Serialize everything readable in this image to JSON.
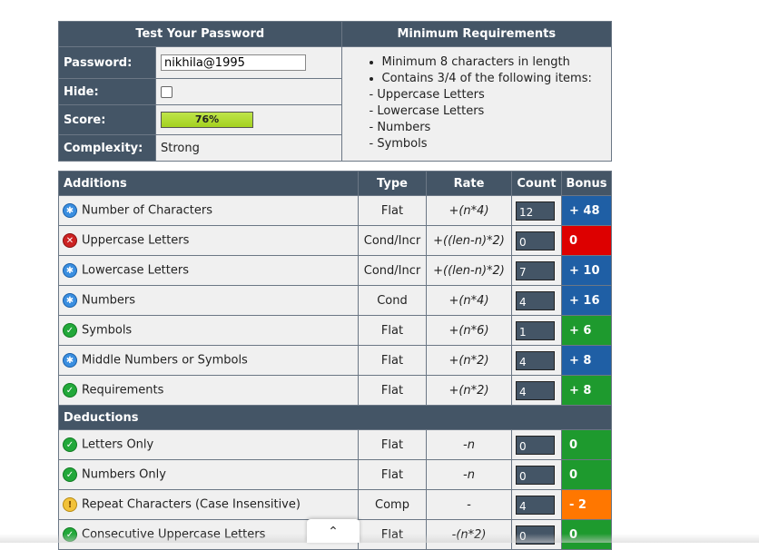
{
  "test": {
    "title": "Test Your Password",
    "password_label": "Password:",
    "password_value": "nikhila@1995",
    "hide_label": "Hide:",
    "score_label": "Score:",
    "score_value": "76%",
    "complexity_label": "Complexity:",
    "complexity_value": "Strong"
  },
  "requirements": {
    "title": "Minimum Requirements",
    "items": [
      "Minimum 8 characters in length",
      "Contains 3/4 of the following items:"
    ],
    "subitems": [
      "- Uppercase Letters",
      "- Lowercase Letters",
      "- Numbers",
      "- Symbols"
    ]
  },
  "headers": {
    "additions": "Additions",
    "type": "Type",
    "rate": "Rate",
    "count": "Count",
    "bonus": "Bonus",
    "deductions": "Deductions"
  },
  "additions": [
    {
      "name": "Number of Characters",
      "type": "Flat",
      "rate": "+(n*4)",
      "count": "12",
      "bonus": "+ 48",
      "status": "exceed",
      "color": "#1f5fa5"
    },
    {
      "name": "Uppercase Letters",
      "type": "Cond/Incr",
      "rate": "+((len-n)*2)",
      "count": "0",
      "bonus": "0",
      "status": "fail",
      "color": "#dd0000"
    },
    {
      "name": "Lowercase Letters",
      "type": "Cond/Incr",
      "rate": "+((len-n)*2)",
      "count": "7",
      "bonus": "+ 10",
      "status": "exceed",
      "color": "#1f5fa5"
    },
    {
      "name": "Numbers",
      "type": "Cond",
      "rate": "+(n*4)",
      "count": "4",
      "bonus": "+ 16",
      "status": "exceed",
      "color": "#1f5fa5"
    },
    {
      "name": "Symbols",
      "type": "Flat",
      "rate": "+(n*6)",
      "count": "1",
      "bonus": "+ 6",
      "status": "pass",
      "color": "#1e9a2e"
    },
    {
      "name": "Middle Numbers or Symbols",
      "type": "Flat",
      "rate": "+(n*2)",
      "count": "4",
      "bonus": "+ 8",
      "status": "exceed",
      "color": "#1f5fa5"
    },
    {
      "name": "Requirements",
      "type": "Flat",
      "rate": "+(n*2)",
      "count": "4",
      "bonus": "+ 8",
      "status": "pass",
      "color": "#1e9a2e"
    }
  ],
  "deductions": [
    {
      "name": "Letters Only",
      "type": "Flat",
      "rate": "-n",
      "count": "0",
      "bonus": "0",
      "status": "pass",
      "color": "#1e9a2e"
    },
    {
      "name": "Numbers Only",
      "type": "Flat",
      "rate": "-n",
      "count": "0",
      "bonus": "0",
      "status": "pass",
      "color": "#1e9a2e"
    },
    {
      "name": "Repeat Characters (Case Insensitive)",
      "type": "Comp",
      "rate": "-",
      "count": "4",
      "bonus": "- 2",
      "status": "warn",
      "color": "#ff7700"
    },
    {
      "name": "Consecutive Uppercase Letters",
      "type": "Flat",
      "rate": "-(n*2)",
      "count": "0",
      "bonus": "0",
      "status": "pass",
      "color": "#1e9a2e"
    }
  ],
  "icons": {
    "pass": "check-icon",
    "fail": "cross-icon",
    "exceed": "star-icon",
    "warn": "exclamation-icon",
    "scroll": "chevron-up-icon"
  }
}
